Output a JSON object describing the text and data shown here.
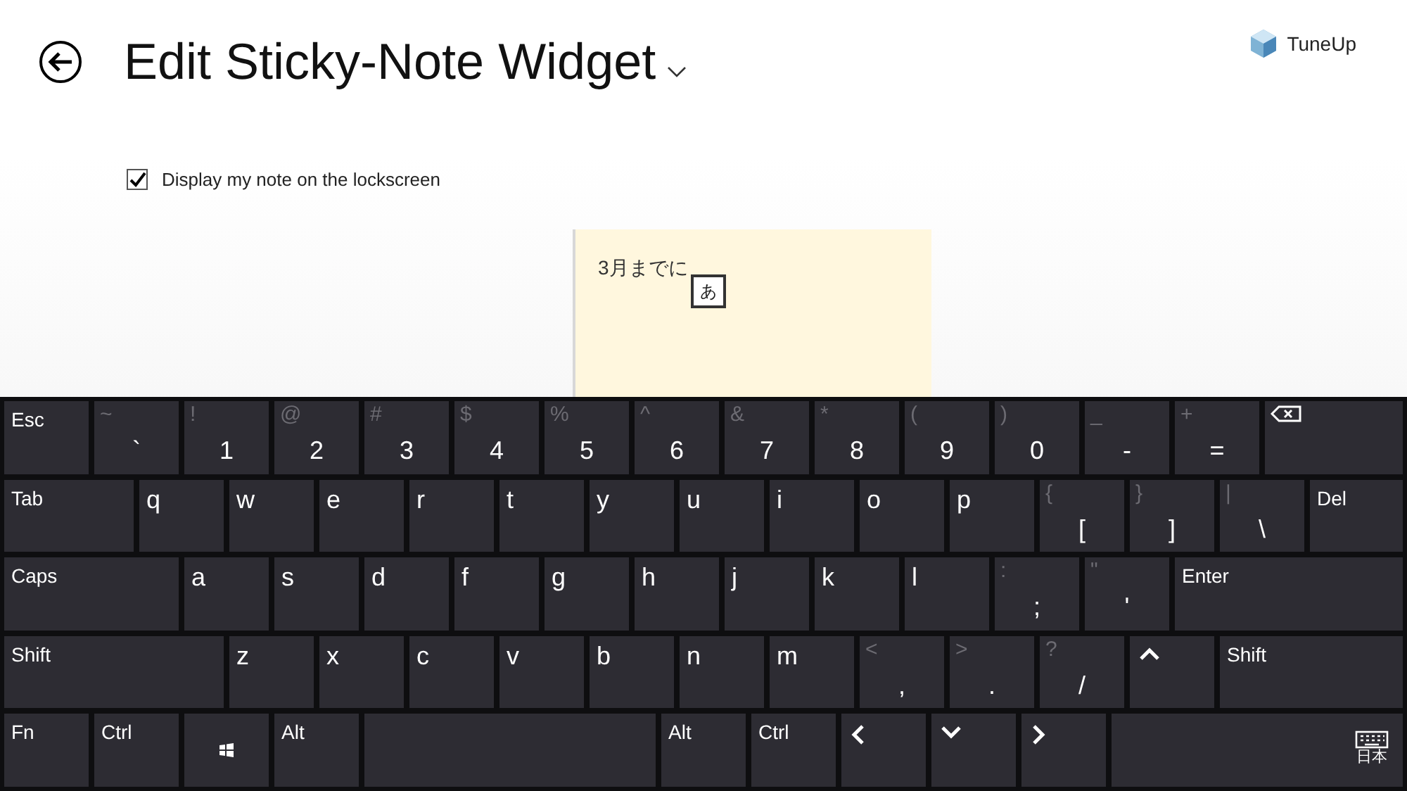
{
  "header": {
    "title": "Edit Sticky-Note Widget",
    "brand": "TuneUp"
  },
  "lockscreen_option": {
    "label": "Display my note on the lockscreen",
    "checked": true
  },
  "note": {
    "text": "3月までに",
    "ime_candidate": "あ"
  },
  "keyboard": {
    "rows": [
      [
        {
          "kind": "label",
          "label": "Esc"
        },
        {
          "kind": "symbol",
          "shift": "~",
          "main": "`"
        },
        {
          "kind": "symbol",
          "shift": "!",
          "main": "1"
        },
        {
          "kind": "symbol",
          "shift": "@",
          "main": "2"
        },
        {
          "kind": "symbol",
          "shift": "#",
          "main": "3"
        },
        {
          "kind": "symbol",
          "shift": "$",
          "main": "4"
        },
        {
          "kind": "symbol",
          "shift": "%",
          "main": "5"
        },
        {
          "kind": "symbol",
          "shift": "^",
          "main": "6"
        },
        {
          "kind": "symbol",
          "shift": "&",
          "main": "7"
        },
        {
          "kind": "symbol",
          "shift": "*",
          "main": "8"
        },
        {
          "kind": "symbol",
          "shift": "(",
          "main": "9"
        },
        {
          "kind": "symbol",
          "shift": ")",
          "main": "0"
        },
        {
          "kind": "symbol",
          "shift": "_",
          "main": "-"
        },
        {
          "kind": "symbol",
          "shift": "+",
          "main": "="
        },
        {
          "kind": "backspace"
        }
      ],
      [
        {
          "kind": "tab",
          "label": "Tab"
        },
        {
          "kind": "letter",
          "main": "q"
        },
        {
          "kind": "letter",
          "main": "w"
        },
        {
          "kind": "letter",
          "main": "e"
        },
        {
          "kind": "letter",
          "main": "r"
        },
        {
          "kind": "letter",
          "main": "t"
        },
        {
          "kind": "letter",
          "main": "y"
        },
        {
          "kind": "letter",
          "main": "u"
        },
        {
          "kind": "letter",
          "main": "i"
        },
        {
          "kind": "letter",
          "main": "o"
        },
        {
          "kind": "letter",
          "main": "p"
        },
        {
          "kind": "symbol",
          "shift": "{",
          "main": "["
        },
        {
          "kind": "symbol",
          "shift": "}",
          "main": "]"
        },
        {
          "kind": "symbol",
          "shift": "|",
          "main": "\\"
        },
        {
          "kind": "wide",
          "label": "Del"
        }
      ],
      [
        {
          "kind": "caps",
          "label": "Caps"
        },
        {
          "kind": "letter",
          "main": "a"
        },
        {
          "kind": "letter",
          "main": "s"
        },
        {
          "kind": "letter",
          "main": "d"
        },
        {
          "kind": "letter",
          "main": "f"
        },
        {
          "kind": "letter",
          "main": "g"
        },
        {
          "kind": "letter",
          "main": "h"
        },
        {
          "kind": "letter",
          "main": "j"
        },
        {
          "kind": "letter",
          "main": "k"
        },
        {
          "kind": "letter",
          "main": "l"
        },
        {
          "kind": "symbol",
          "shift": ":",
          "main": ";"
        },
        {
          "kind": "symbol",
          "shift": "\"",
          "main": "'"
        },
        {
          "kind": "wide",
          "label": "Enter"
        }
      ],
      [
        {
          "kind": "shift",
          "label": "Shift"
        },
        {
          "kind": "letter",
          "main": "z"
        },
        {
          "kind": "letter",
          "main": "x"
        },
        {
          "kind": "letter",
          "main": "c"
        },
        {
          "kind": "letter",
          "main": "v"
        },
        {
          "kind": "letter",
          "main": "b"
        },
        {
          "kind": "letter",
          "main": "n"
        },
        {
          "kind": "letter",
          "main": "m"
        },
        {
          "kind": "symbol",
          "shift": "<",
          "main": ","
        },
        {
          "kind": "symbol",
          "shift": ">",
          "main": "."
        },
        {
          "kind": "symbol",
          "shift": "?",
          "main": "/"
        },
        {
          "kind": "up"
        },
        {
          "kind": "wide",
          "label": "Shift"
        }
      ],
      [
        {
          "kind": "label",
          "label": "Fn"
        },
        {
          "kind": "label",
          "label": "Ctrl"
        },
        {
          "kind": "windows"
        },
        {
          "kind": "label",
          "label": "Alt"
        },
        {
          "kind": "space"
        },
        {
          "kind": "label",
          "label": "Alt"
        },
        {
          "kind": "label",
          "label": "Ctrl"
        },
        {
          "kind": "left"
        },
        {
          "kind": "down"
        },
        {
          "kind": "right"
        },
        {
          "kind": "language",
          "label": "日本"
        }
      ]
    ]
  }
}
